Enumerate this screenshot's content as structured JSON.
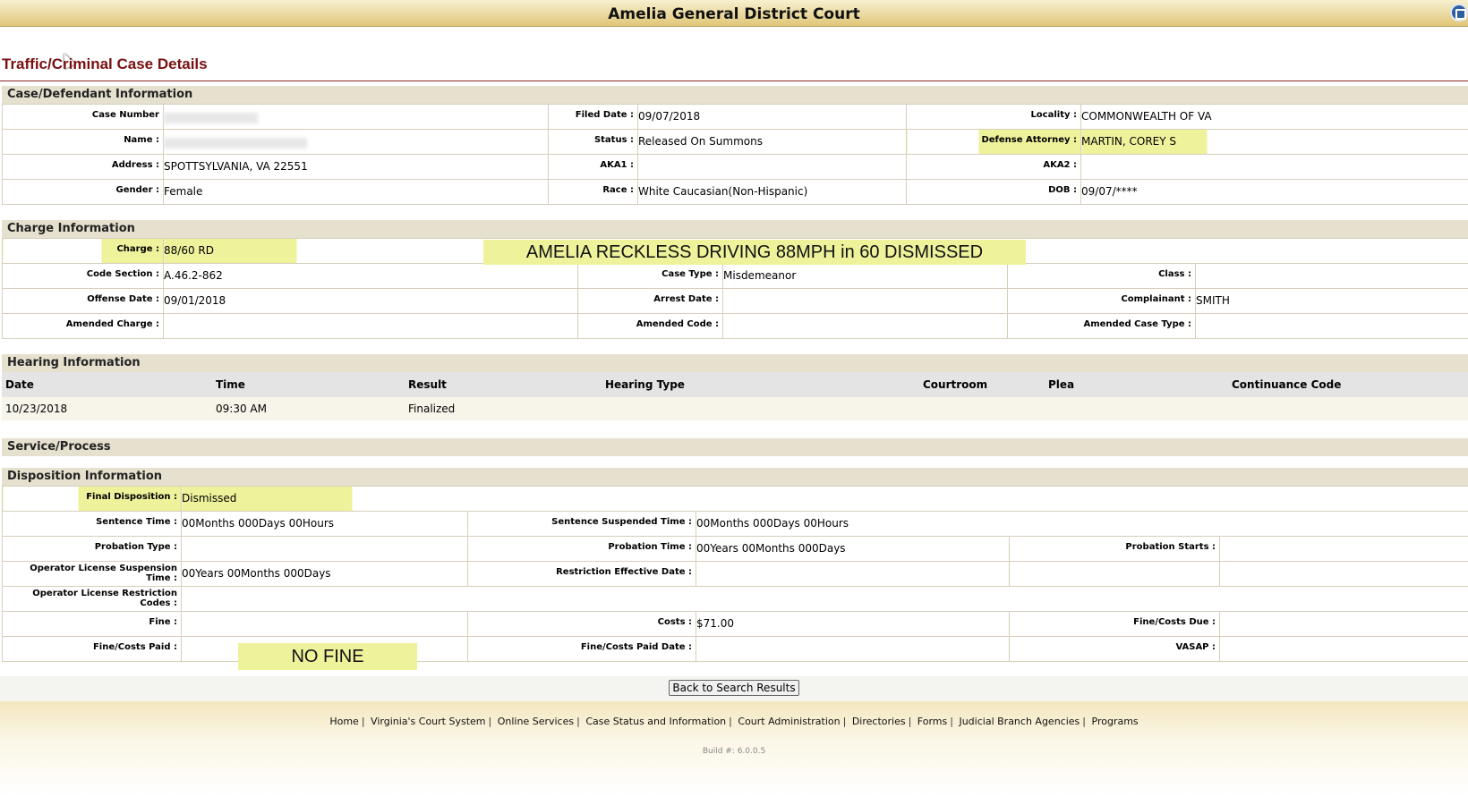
{
  "header": {
    "title": "Amelia General District Court",
    "home_icon": "home-icon"
  },
  "page_title": "Traffic/Criminal Case Details",
  "case_info": {
    "heading": "Case/Defendant Information",
    "case_number_label": "Case Number",
    "filed_date_label": "Filed Date :",
    "filed_date": "09/07/2018",
    "locality_label": "Locality :",
    "locality": "COMMONWEALTH OF VA",
    "name_label": "Name :",
    "status_label": "Status :",
    "status": "Released On Summons",
    "defense_attorney_label": "Defense Attorney :",
    "defense_attorney": "MARTIN, COREY S",
    "address_label": "Address :",
    "address": "SPOTTSYLVANIA, VA 22551",
    "aka1_label": "AKA1 :",
    "aka2_label": "AKA2 :",
    "gender_label": "Gender :",
    "gender": "Female",
    "race_label": "Race :",
    "race": "White Caucasian(Non-Hispanic)",
    "dob_label": "DOB :",
    "dob": "09/07/****"
  },
  "charge_info": {
    "heading": "Charge Information",
    "charge_label": "Charge :",
    "charge": "88/60 RD",
    "annotation": "AMELIA RECKLESS DRIVING 88MPH in 60 DISMISSED",
    "code_section_label": "Code Section :",
    "code_section": "A.46.2-862",
    "case_type_label": "Case Type :",
    "case_type": "Misdemeanor",
    "class_label": "Class :",
    "offense_date_label": "Offense Date :",
    "offense_date": "09/01/2018",
    "arrest_date_label": "Arrest Date :",
    "complainant_label": "Complainant :",
    "complainant": "SMITH",
    "amended_charge_label": "Amended Charge :",
    "amended_code_label": "Amended Code :",
    "amended_case_type_label": "Amended Case Type :"
  },
  "hearing_info": {
    "heading": "Hearing Information",
    "columns": [
      "Date",
      "Time",
      "Result",
      "Hearing Type",
      "Courtroom",
      "Plea",
      "Continuance Code"
    ],
    "rows": [
      [
        "10/23/2018",
        "09:30 AM",
        "Finalized",
        "",
        "",
        "",
        ""
      ]
    ]
  },
  "service_process": {
    "heading": "Service/Process"
  },
  "disposition_info": {
    "heading": "Disposition Information",
    "final_disposition_label": "Final Disposition :",
    "final_disposition": "Dismissed",
    "sentence_time_label": "Sentence Time :",
    "sentence_time": "00Months 000Days 00Hours",
    "sentence_suspended_label": "Sentence Suspended Time :",
    "sentence_suspended": "00Months 000Days 00Hours",
    "probation_type_label": "Probation Type :",
    "probation_time_label": "Probation Time :",
    "probation_time": "00Years 00Months 000Days",
    "probation_starts_label": "Probation Starts :",
    "ol_suspension_label_1": "Operator License Suspension",
    "ol_suspension_label_2": "Time :",
    "ol_suspension": "00Years 00Months 000Days",
    "restriction_effective_label": "Restriction Effective Date :",
    "ol_restriction_label_1": "Operator License Restriction",
    "ol_restriction_label_2": "Codes :",
    "fine_label": "Fine :",
    "fine_annotation": "NO FINE",
    "costs_label": "Costs :",
    "costs": "$71.00",
    "fine_costs_due_label": "Fine/Costs Due :",
    "fine_costs_paid_label": "Fine/Costs Paid :",
    "fine_costs_paid_date_label": "Fine/Costs Paid Date :",
    "vasap_label": "VASAP :"
  },
  "back_button": "Back to Search Results",
  "footer": {
    "links": [
      "Home",
      "Virginia's Court System",
      "Online Services",
      "Case Status and Information",
      "Court Administration",
      "Directories",
      "Forms",
      "Judicial Branch Agencies",
      "Programs"
    ],
    "separator": "|",
    "build": "Build #: 6.0.0.5"
  },
  "colors": {
    "header_gradient": "#e0c676",
    "title": "#7a1010",
    "highlight": "#eef29b",
    "section_bg": "#e6e0cf"
  }
}
